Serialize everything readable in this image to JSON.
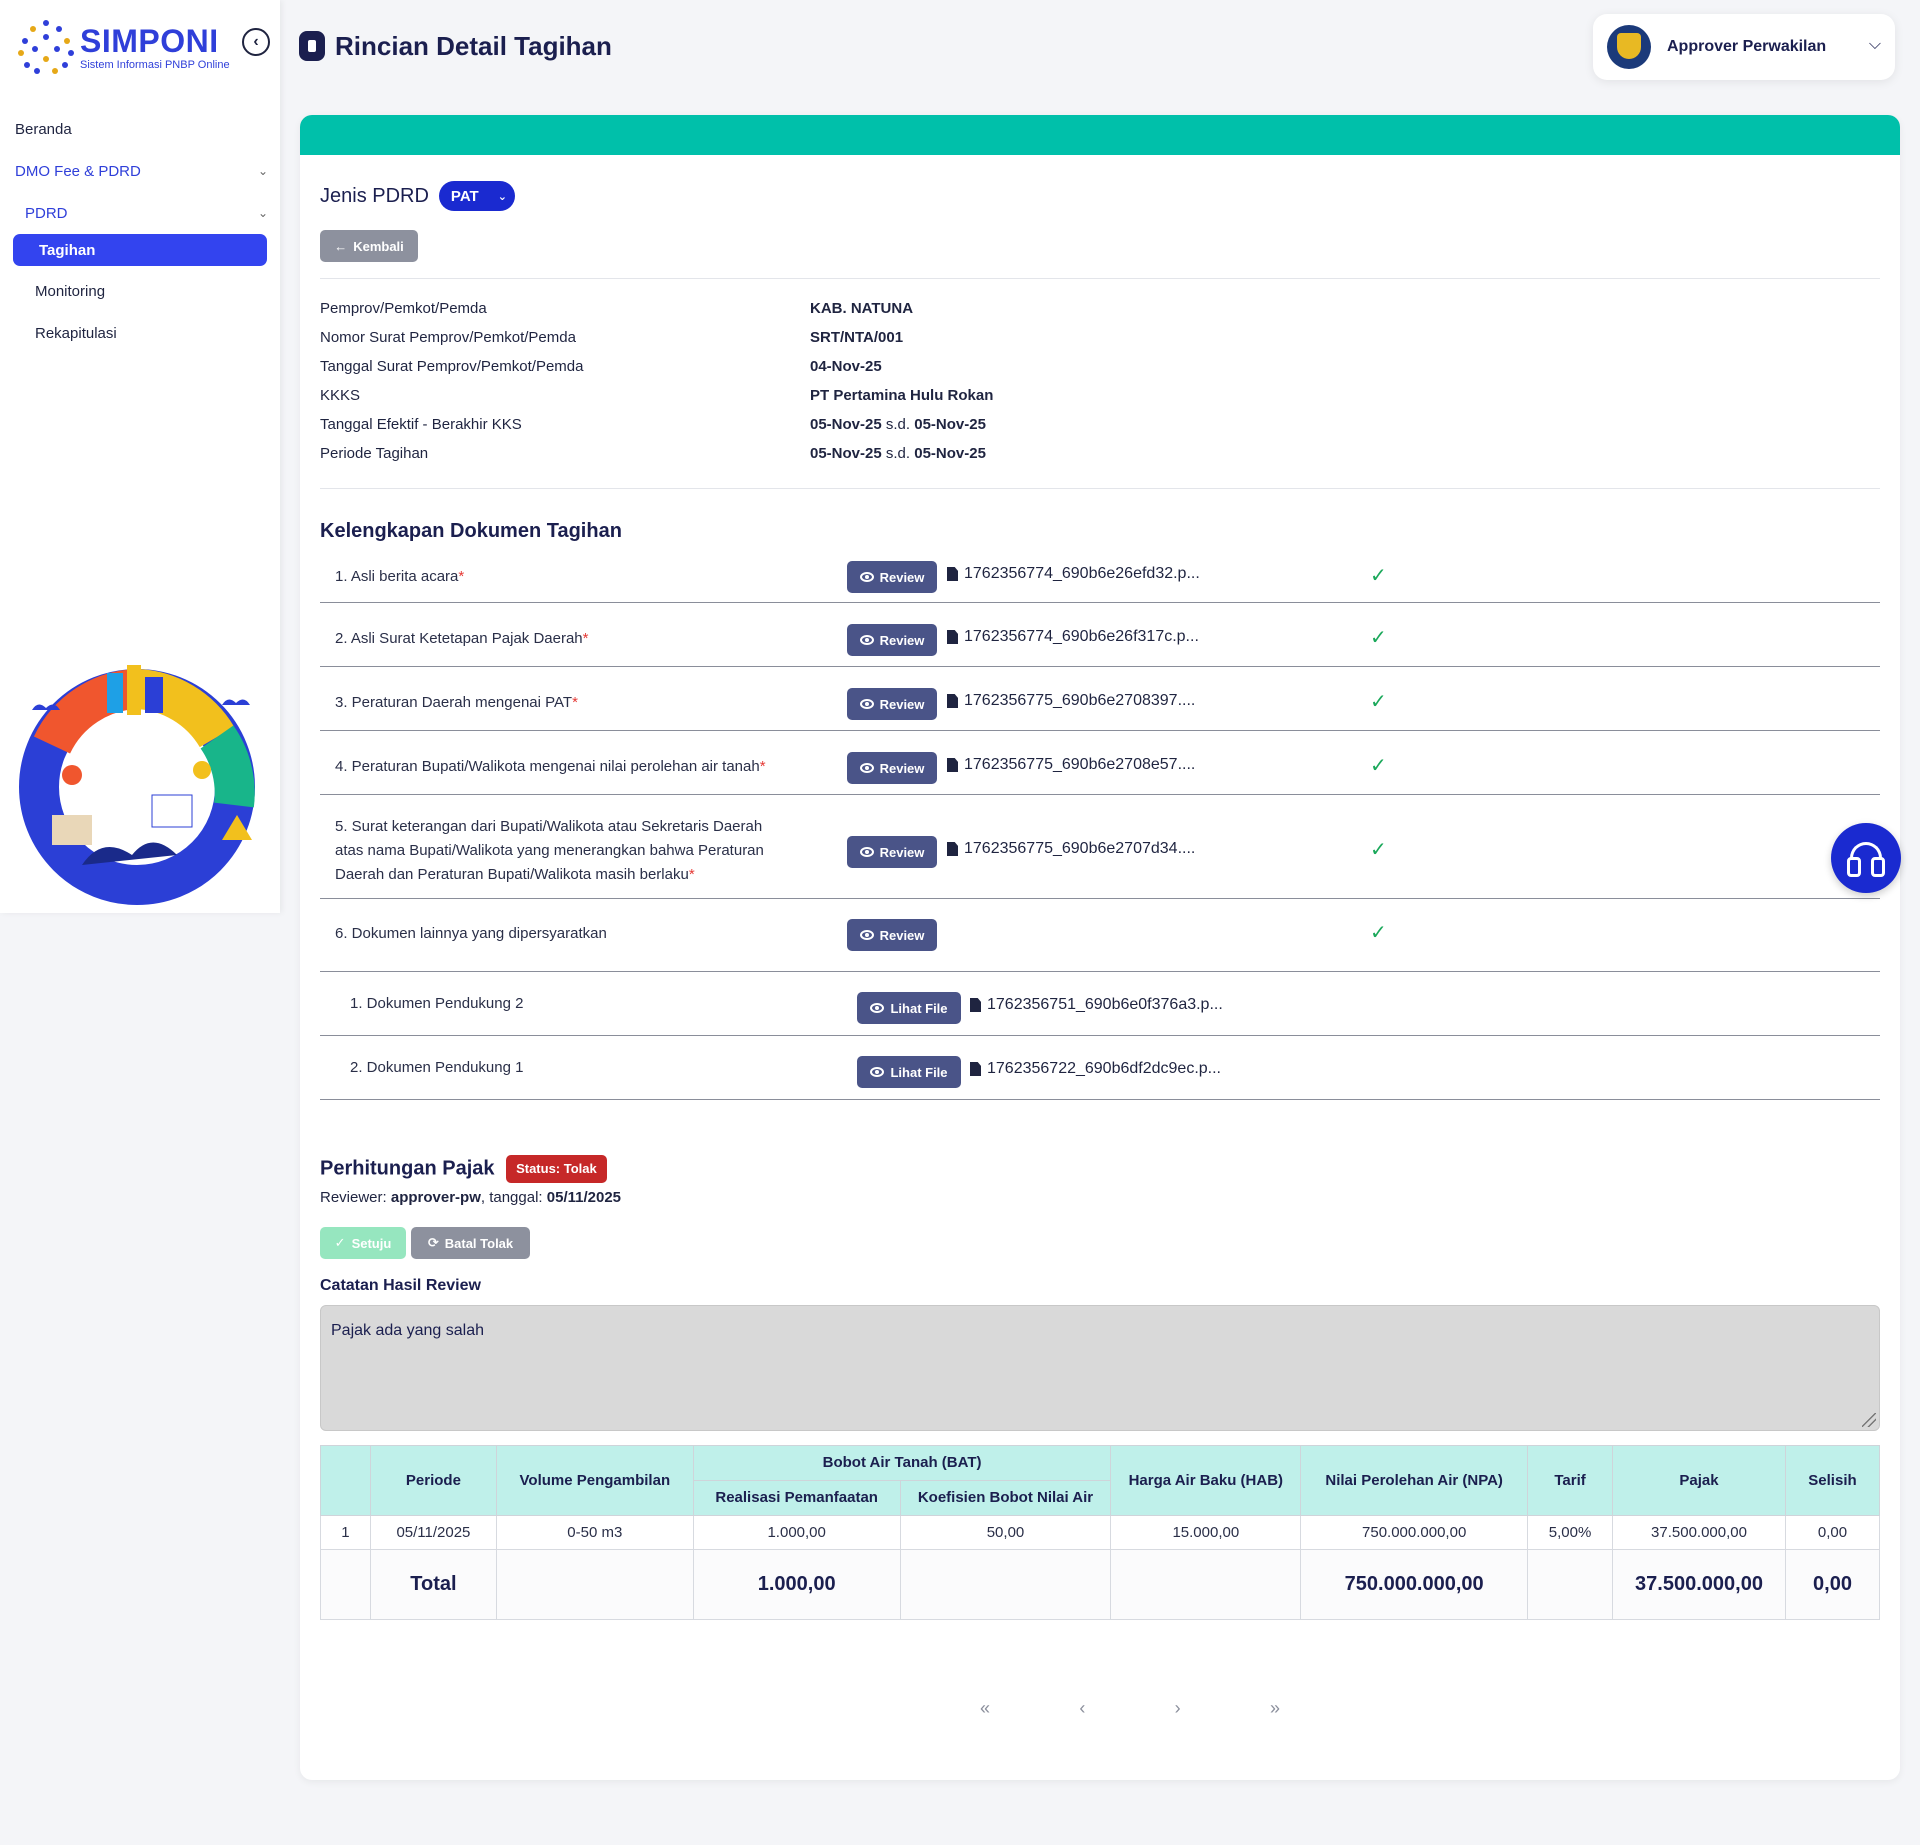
{
  "app": {
    "logo_title": "SIMPONI",
    "logo_subtitle": "Sistem Informasi PNBP Online",
    "page_title": "Rincian Detail Tagihan"
  },
  "user": {
    "role": "Approver Perwakilan"
  },
  "sidebar": {
    "items": [
      {
        "label": "Beranda"
      },
      {
        "label": "DMO Fee & PDRD"
      },
      {
        "label": "PDRD"
      },
      {
        "label": "Tagihan"
      },
      {
        "label": "Monitoring"
      },
      {
        "label": "Rekapitulasi"
      }
    ]
  },
  "jenis": {
    "label": "Jenis PDRD",
    "selected": "PAT"
  },
  "back_label": "Kembali",
  "info": [
    {
      "key": "Pemprov/Pemkot/Pemda",
      "value": "KAB. NATUNA"
    },
    {
      "key": "Nomor Surat Pemprov/Pemkot/Pemda",
      "value": "SRT/NTA/001"
    },
    {
      "key": "Tanggal Surat Pemprov/Pemkot/Pemda",
      "value": "04-Nov-25"
    },
    {
      "key": "KKKS",
      "value": "PT Pertamina Hulu Rokan"
    },
    {
      "key": "Tanggal Efektif - Berakhir KKS",
      "from": "05-Nov-25",
      "sep": "s.d.",
      "to": "05-Nov-25"
    },
    {
      "key": "Periode Tagihan",
      "from": "05-Nov-25",
      "sep": "s.d.",
      "to": "05-Nov-25"
    }
  ],
  "docs": {
    "title": "Kelengkapan Dokumen Tagihan",
    "review_label": "Review",
    "lihat_label": "Lihat File",
    "required_mark": "*",
    "items": [
      {
        "label": "1. Asli berita acara",
        "file": "1762356774_690b6e26efd32.p..."
      },
      {
        "label": "2. Asli Surat Ketetapan Pajak Daerah",
        "file": "1762356774_690b6e26f317c.p..."
      },
      {
        "label": "3. Peraturan Daerah mengenai PAT",
        "file": "1762356775_690b6e2708397...."
      },
      {
        "label": "4. Peraturan Bupati/Walikota mengenai nilai perolehan air tanah",
        "file": "1762356775_690b6e2708e57...."
      },
      {
        "label_lines": [
          "5. Surat keterangan dari Bupati/Walikota atau Sekretaris Daerah",
          "atas nama Bupati/Walikota yang menerangkan bahwa Peraturan",
          "Daerah dan Peraturan Bupati/Walikota masih berlaku"
        ],
        "file": "1762356775_690b6e2707d34...."
      },
      {
        "label": "6. Dokumen lainnya yang dipersyaratkan"
      }
    ],
    "sub_items": [
      {
        "label": "1. Dokumen Pendukung 2",
        "file": "1762356751_690b6e0f376a3.p..."
      },
      {
        "label": "2. Dokumen Pendukung 1",
        "file": "1762356722_690b6df2dc9ec.p..."
      }
    ]
  },
  "pajak": {
    "title": "Perhitungan Pajak",
    "status": "Status: Tolak",
    "reviewer_label": "Reviewer:",
    "reviewer": "approver-pw",
    "tanggal_label": ", tanggal:",
    "tanggal": "05/11/2025",
    "setuju_label": "Setuju",
    "batal_label": "Batal Tolak",
    "catatan_label": "Catatan Hasil Review",
    "catatan": "Pajak ada yang salah"
  },
  "table": {
    "headers": {
      "periode": "Periode",
      "volume": "Volume Pengambilan",
      "bat": "Bobot Air Tanah (BAT)",
      "realisasi": "Realisasi Pemanfaatan",
      "koefisien": "Koefisien Bobot Nilai Air",
      "hab": "Harga Air Baku (HAB)",
      "npa": "Nilai Perolehan Air (NPA)",
      "tarif": "Tarif",
      "pajak": "Pajak",
      "selisih": "Selisih"
    },
    "rows": [
      {
        "no": "1",
        "periode": "05/11/2025",
        "volume": "0-50 m3",
        "realisasi": "1.000,00",
        "koefisien": "50,00",
        "hab": "15.000,00",
        "npa": "750.000.000,00",
        "tarif": "5,00%",
        "pajak": "37.500.000,00",
        "selisih": "0,00"
      }
    ],
    "total": {
      "label": "Total",
      "realisasi": "1.000,00",
      "npa": "750.000.000,00",
      "pajak": "37.500.000,00",
      "selisih": "0,00"
    }
  },
  "pager": {
    "first": "«",
    "prev": "‹",
    "next": "›",
    "last": "»"
  },
  "colors": {
    "primary": "#3344ef",
    "teal": "#00c0aa",
    "danger": "#c62828",
    "success": "#1aa85a"
  }
}
